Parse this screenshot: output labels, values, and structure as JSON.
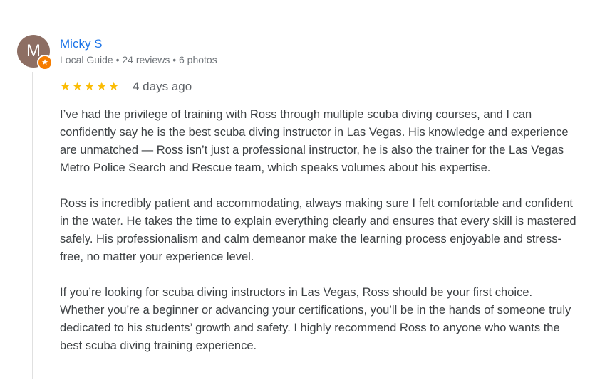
{
  "reviewer": {
    "initial": "M",
    "name": "Micky S",
    "meta": "Local Guide • 24 reviews • 6 photos",
    "avatar_color": "#8d6e63",
    "badge_color": "#f57c00",
    "badge_icon": "local-guide-star-icon"
  },
  "rating": {
    "stars": 5,
    "star_glyph": "★",
    "star_color": "#fbbc04",
    "date": "4 days ago"
  },
  "review": {
    "paragraphs": [
      "I’ve had the privilege of training with Ross through multiple scuba diving courses, and I can confidently say he is the best scuba diving instructor in Las Vegas. His knowledge and experience are unmatched — Ross isn’t just a professional instructor, he is also the trainer for the Las Vegas Metro Police Search and Rescue team, which speaks volumes about his expertise.",
      "Ross is incredibly patient and accommodating, always making sure I felt comfortable and confident in the water. He takes the time to explain everything clearly and ensures that every skill is mastered safely. His professionalism and calm demeanor make the learning process enjoyable and stress-free, no matter your experience level.",
      "If you’re looking for scuba diving instructors in Las Vegas, Ross should be your first choice. Whether you’re a beginner or advancing your certifications, you’ll be in the hands of someone truly dedicated to his students’ growth and safety. I highly recommend Ross to anyone who wants the best scuba diving training experience."
    ]
  },
  "colors": {
    "name_link": "#1a73e8",
    "meta_text": "#70757a",
    "body_text": "#3c4043"
  }
}
